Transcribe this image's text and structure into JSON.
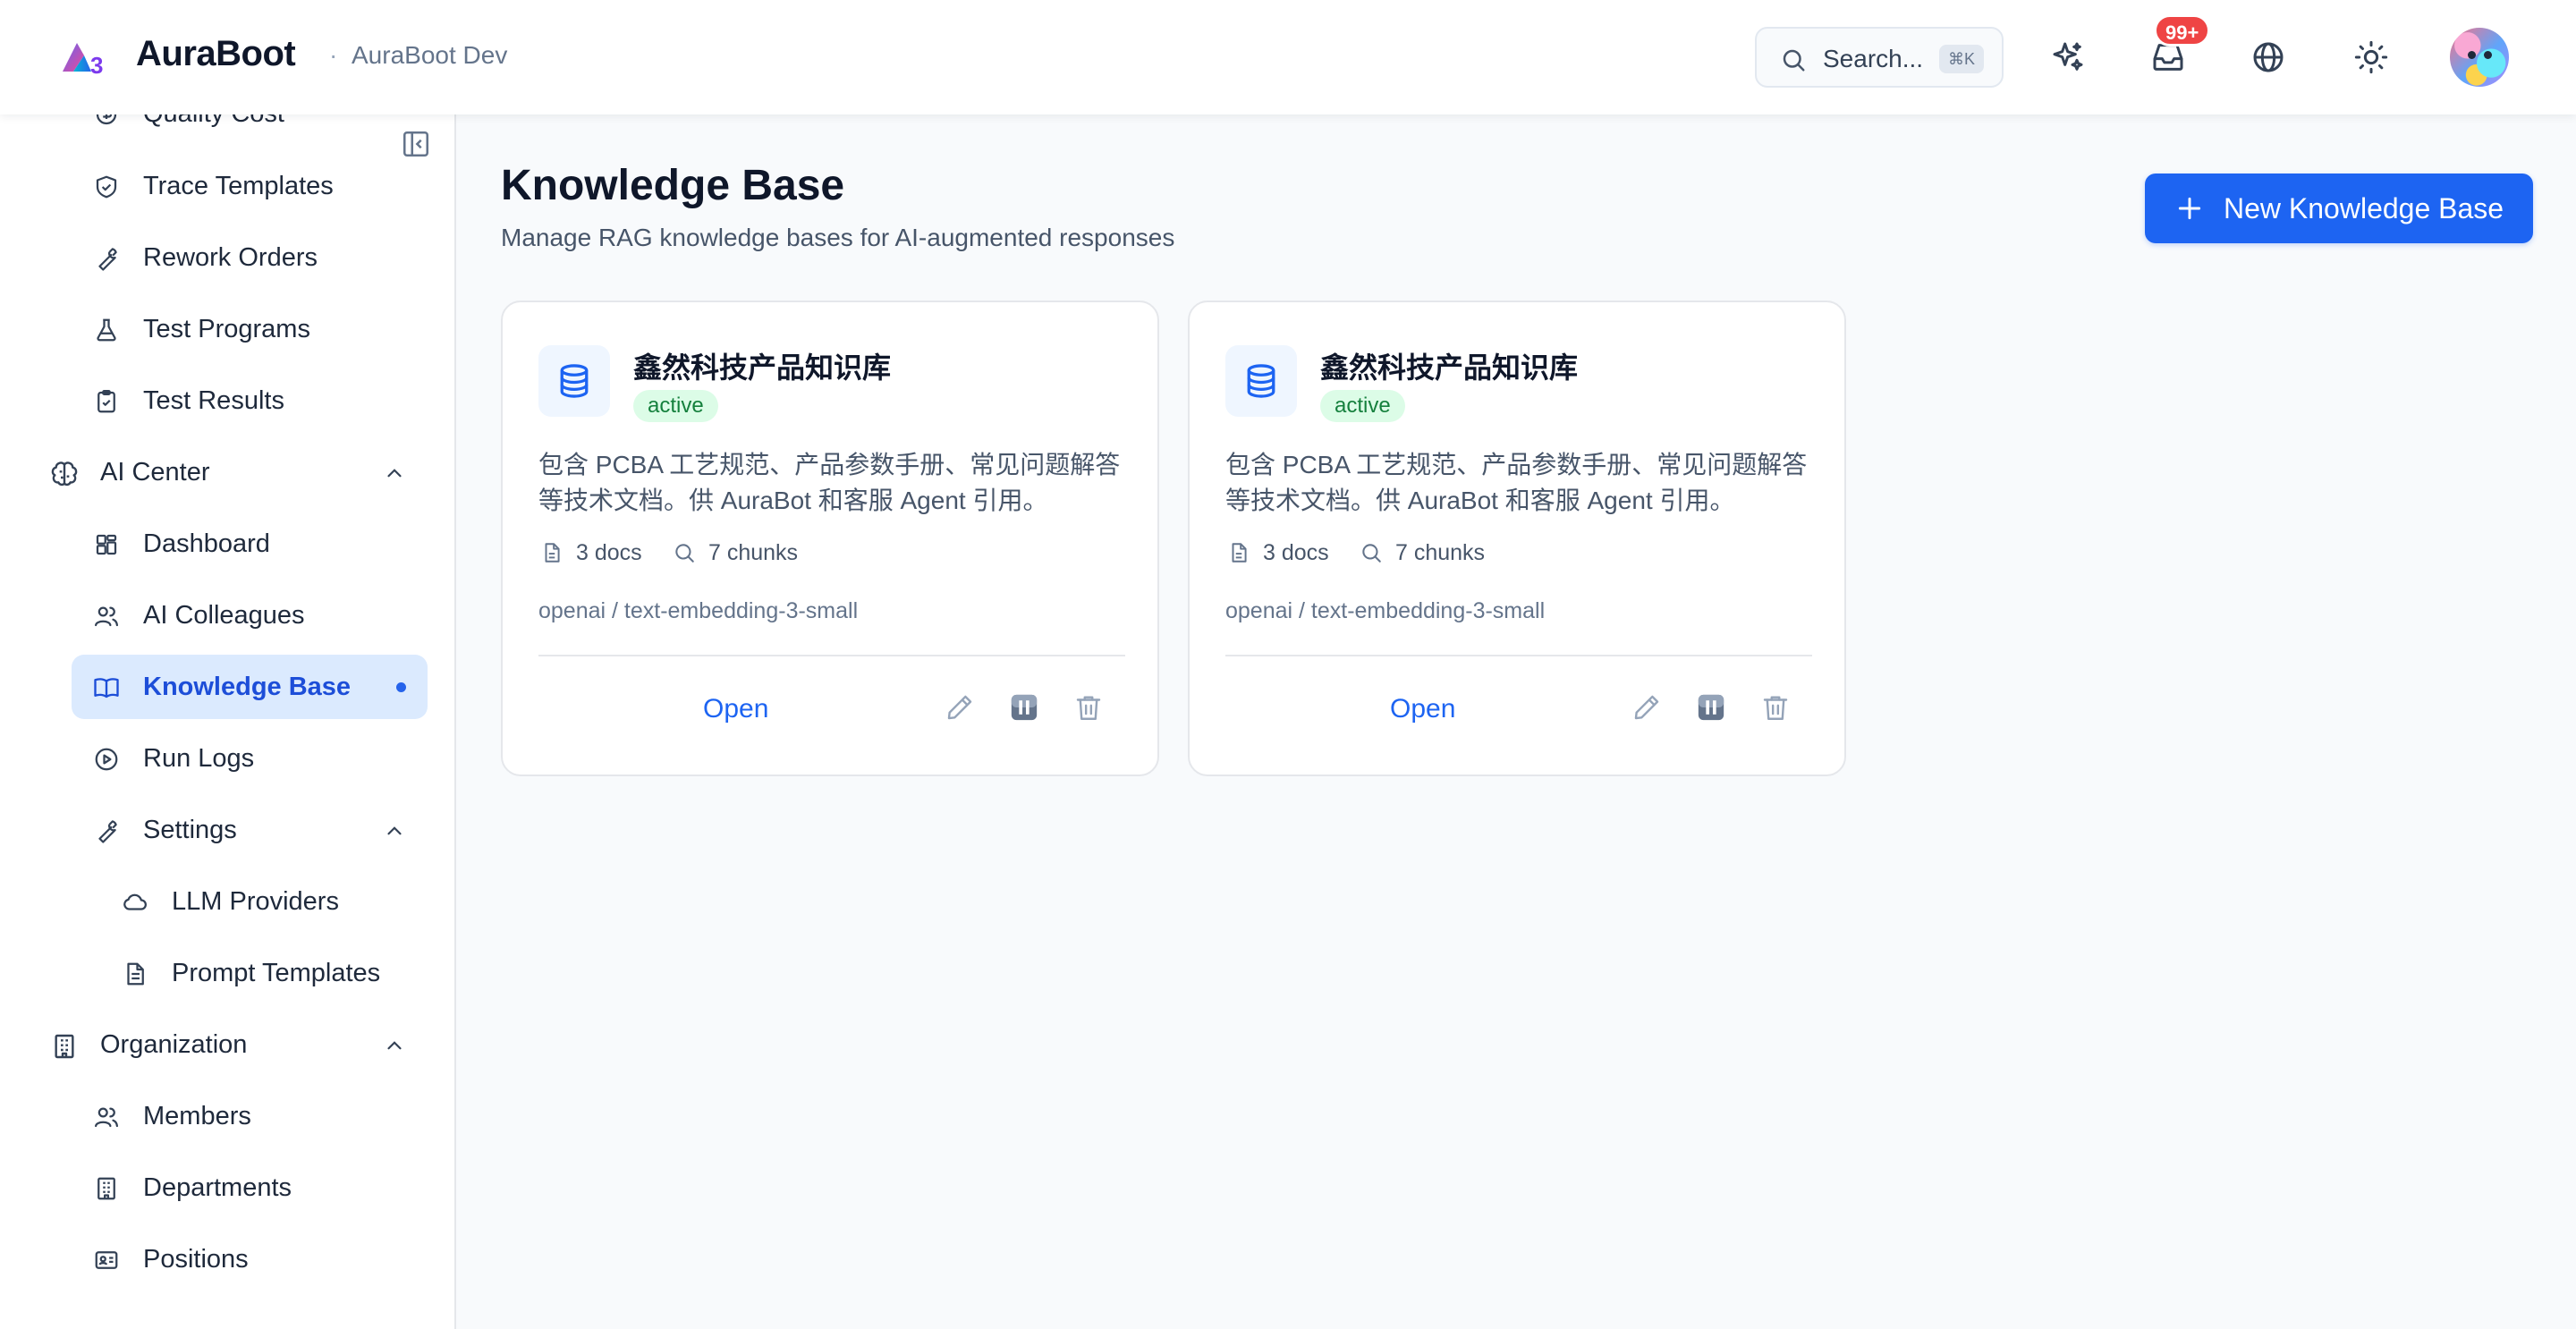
{
  "header": {
    "brand": "AuraBoot",
    "separator": "·",
    "environment": "AuraBoot Dev",
    "search_placeholder": "Search...",
    "search_shortcut": "⌘K",
    "inbox_badge": "99+",
    "icons": [
      "logo-icon",
      "search-icon",
      "sparkles-icon",
      "inbox-icon",
      "globe-icon",
      "sun-icon",
      "avatar"
    ]
  },
  "sidebar": {
    "items": [
      {
        "label": "Quality Cost",
        "icon": "quality-cost-icon"
      },
      {
        "label": "Trace Templates",
        "icon": "shield-icon"
      },
      {
        "label": "Rework Orders",
        "icon": "wrench-icon"
      },
      {
        "label": "Test Programs",
        "icon": "flask-icon"
      },
      {
        "label": "Test Results",
        "icon": "clipboard-check-icon"
      },
      {
        "label": "AI Center",
        "icon": "brain-icon",
        "group": true,
        "expanded": true
      },
      {
        "label": "Dashboard",
        "icon": "dashboard-icon"
      },
      {
        "label": "AI Colleagues",
        "icon": "users-icon"
      },
      {
        "label": "Knowledge Base",
        "icon": "book-icon",
        "active": true
      },
      {
        "label": "Run Logs",
        "icon": "play-circle-icon"
      },
      {
        "label": "Settings",
        "icon": "wrench-icon",
        "group": true,
        "expanded": true
      },
      {
        "label": "LLM Providers",
        "icon": "cloud-icon"
      },
      {
        "label": "Prompt Templates",
        "icon": "file-text-icon"
      },
      {
        "label": "Organization",
        "icon": "building-icon",
        "group": true,
        "expanded": true
      },
      {
        "label": "Members",
        "icon": "users-icon"
      },
      {
        "label": "Departments",
        "icon": "building-icon"
      },
      {
        "label": "Positions",
        "icon": "id-card-icon"
      }
    ]
  },
  "main": {
    "title": "Knowledge Base",
    "subtitle": "Manage RAG knowledge bases for AI-augmented responses",
    "new_button": "New Knowledge Base",
    "cards": [
      {
        "name": "鑫然科技产品知识库",
        "status": "active",
        "description": "包含 PCBA 工艺规范、产品参数手册、常见问题解答等技术文档。供 AuraBot 和客服 Agent 引用。",
        "docs": "3 docs",
        "chunks": "7 chunks",
        "model": "openai / text-embedding-3-small",
        "open_label": "Open"
      },
      {
        "name": "鑫然科技产品知识库",
        "status": "active",
        "description": "包含 PCBA 工艺规范、产品参数手册、常见问题解答等技术文档。供 AuraBot 和客服 Agent 引用。",
        "docs": "3 docs",
        "chunks": "7 chunks",
        "model": "openai / text-embedding-3-small",
        "open_label": "Open"
      }
    ]
  },
  "colors": {
    "primary": "#1d64f2",
    "active_bg": "#dbeafe",
    "status_bg": "#dcfce7",
    "status_text": "#15803d",
    "badge": "#ef4444"
  }
}
